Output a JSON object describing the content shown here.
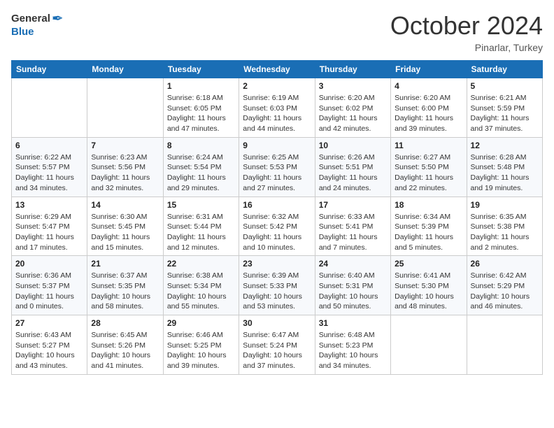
{
  "header": {
    "logo": {
      "general": "General",
      "blue": "Blue"
    },
    "title": "October 2024",
    "location": "Pinarlar, Turkey"
  },
  "weekdays": [
    "Sunday",
    "Monday",
    "Tuesday",
    "Wednesday",
    "Thursday",
    "Friday",
    "Saturday"
  ],
  "weeks": [
    [
      {
        "day": null,
        "sunrise": null,
        "sunset": null,
        "daylight": null
      },
      {
        "day": null,
        "sunrise": null,
        "sunset": null,
        "daylight": null
      },
      {
        "day": "1",
        "sunrise": "Sunrise: 6:18 AM",
        "sunset": "Sunset: 6:05 PM",
        "daylight": "Daylight: 11 hours and 47 minutes."
      },
      {
        "day": "2",
        "sunrise": "Sunrise: 6:19 AM",
        "sunset": "Sunset: 6:03 PM",
        "daylight": "Daylight: 11 hours and 44 minutes."
      },
      {
        "day": "3",
        "sunrise": "Sunrise: 6:20 AM",
        "sunset": "Sunset: 6:02 PM",
        "daylight": "Daylight: 11 hours and 42 minutes."
      },
      {
        "day": "4",
        "sunrise": "Sunrise: 6:20 AM",
        "sunset": "Sunset: 6:00 PM",
        "daylight": "Daylight: 11 hours and 39 minutes."
      },
      {
        "day": "5",
        "sunrise": "Sunrise: 6:21 AM",
        "sunset": "Sunset: 5:59 PM",
        "daylight": "Daylight: 11 hours and 37 minutes."
      }
    ],
    [
      {
        "day": "6",
        "sunrise": "Sunrise: 6:22 AM",
        "sunset": "Sunset: 5:57 PM",
        "daylight": "Daylight: 11 hours and 34 minutes."
      },
      {
        "day": "7",
        "sunrise": "Sunrise: 6:23 AM",
        "sunset": "Sunset: 5:56 PM",
        "daylight": "Daylight: 11 hours and 32 minutes."
      },
      {
        "day": "8",
        "sunrise": "Sunrise: 6:24 AM",
        "sunset": "Sunset: 5:54 PM",
        "daylight": "Daylight: 11 hours and 29 minutes."
      },
      {
        "day": "9",
        "sunrise": "Sunrise: 6:25 AM",
        "sunset": "Sunset: 5:53 PM",
        "daylight": "Daylight: 11 hours and 27 minutes."
      },
      {
        "day": "10",
        "sunrise": "Sunrise: 6:26 AM",
        "sunset": "Sunset: 5:51 PM",
        "daylight": "Daylight: 11 hours and 24 minutes."
      },
      {
        "day": "11",
        "sunrise": "Sunrise: 6:27 AM",
        "sunset": "Sunset: 5:50 PM",
        "daylight": "Daylight: 11 hours and 22 minutes."
      },
      {
        "day": "12",
        "sunrise": "Sunrise: 6:28 AM",
        "sunset": "Sunset: 5:48 PM",
        "daylight": "Daylight: 11 hours and 19 minutes."
      }
    ],
    [
      {
        "day": "13",
        "sunrise": "Sunrise: 6:29 AM",
        "sunset": "Sunset: 5:47 PM",
        "daylight": "Daylight: 11 hours and 17 minutes."
      },
      {
        "day": "14",
        "sunrise": "Sunrise: 6:30 AM",
        "sunset": "Sunset: 5:45 PM",
        "daylight": "Daylight: 11 hours and 15 minutes."
      },
      {
        "day": "15",
        "sunrise": "Sunrise: 6:31 AM",
        "sunset": "Sunset: 5:44 PM",
        "daylight": "Daylight: 11 hours and 12 minutes."
      },
      {
        "day": "16",
        "sunrise": "Sunrise: 6:32 AM",
        "sunset": "Sunset: 5:42 PM",
        "daylight": "Daylight: 11 hours and 10 minutes."
      },
      {
        "day": "17",
        "sunrise": "Sunrise: 6:33 AM",
        "sunset": "Sunset: 5:41 PM",
        "daylight": "Daylight: 11 hours and 7 minutes."
      },
      {
        "day": "18",
        "sunrise": "Sunrise: 6:34 AM",
        "sunset": "Sunset: 5:39 PM",
        "daylight": "Daylight: 11 hours and 5 minutes."
      },
      {
        "day": "19",
        "sunrise": "Sunrise: 6:35 AM",
        "sunset": "Sunset: 5:38 PM",
        "daylight": "Daylight: 11 hours and 2 minutes."
      }
    ],
    [
      {
        "day": "20",
        "sunrise": "Sunrise: 6:36 AM",
        "sunset": "Sunset: 5:37 PM",
        "daylight": "Daylight: 11 hours and 0 minutes."
      },
      {
        "day": "21",
        "sunrise": "Sunrise: 6:37 AM",
        "sunset": "Sunset: 5:35 PM",
        "daylight": "Daylight: 10 hours and 58 minutes."
      },
      {
        "day": "22",
        "sunrise": "Sunrise: 6:38 AM",
        "sunset": "Sunset: 5:34 PM",
        "daylight": "Daylight: 10 hours and 55 minutes."
      },
      {
        "day": "23",
        "sunrise": "Sunrise: 6:39 AM",
        "sunset": "Sunset: 5:33 PM",
        "daylight": "Daylight: 10 hours and 53 minutes."
      },
      {
        "day": "24",
        "sunrise": "Sunrise: 6:40 AM",
        "sunset": "Sunset: 5:31 PM",
        "daylight": "Daylight: 10 hours and 50 minutes."
      },
      {
        "day": "25",
        "sunrise": "Sunrise: 6:41 AM",
        "sunset": "Sunset: 5:30 PM",
        "daylight": "Daylight: 10 hours and 48 minutes."
      },
      {
        "day": "26",
        "sunrise": "Sunrise: 6:42 AM",
        "sunset": "Sunset: 5:29 PM",
        "daylight": "Daylight: 10 hours and 46 minutes."
      }
    ],
    [
      {
        "day": "27",
        "sunrise": "Sunrise: 6:43 AM",
        "sunset": "Sunset: 5:27 PM",
        "daylight": "Daylight: 10 hours and 43 minutes."
      },
      {
        "day": "28",
        "sunrise": "Sunrise: 6:45 AM",
        "sunset": "Sunset: 5:26 PM",
        "daylight": "Daylight: 10 hours and 41 minutes."
      },
      {
        "day": "29",
        "sunrise": "Sunrise: 6:46 AM",
        "sunset": "Sunset: 5:25 PM",
        "daylight": "Daylight: 10 hours and 39 minutes."
      },
      {
        "day": "30",
        "sunrise": "Sunrise: 6:47 AM",
        "sunset": "Sunset: 5:24 PM",
        "daylight": "Daylight: 10 hours and 37 minutes."
      },
      {
        "day": "31",
        "sunrise": "Sunrise: 6:48 AM",
        "sunset": "Sunset: 5:23 PM",
        "daylight": "Daylight: 10 hours and 34 minutes."
      },
      {
        "day": null,
        "sunrise": null,
        "sunset": null,
        "daylight": null
      },
      {
        "day": null,
        "sunrise": null,
        "sunset": null,
        "daylight": null
      }
    ]
  ]
}
